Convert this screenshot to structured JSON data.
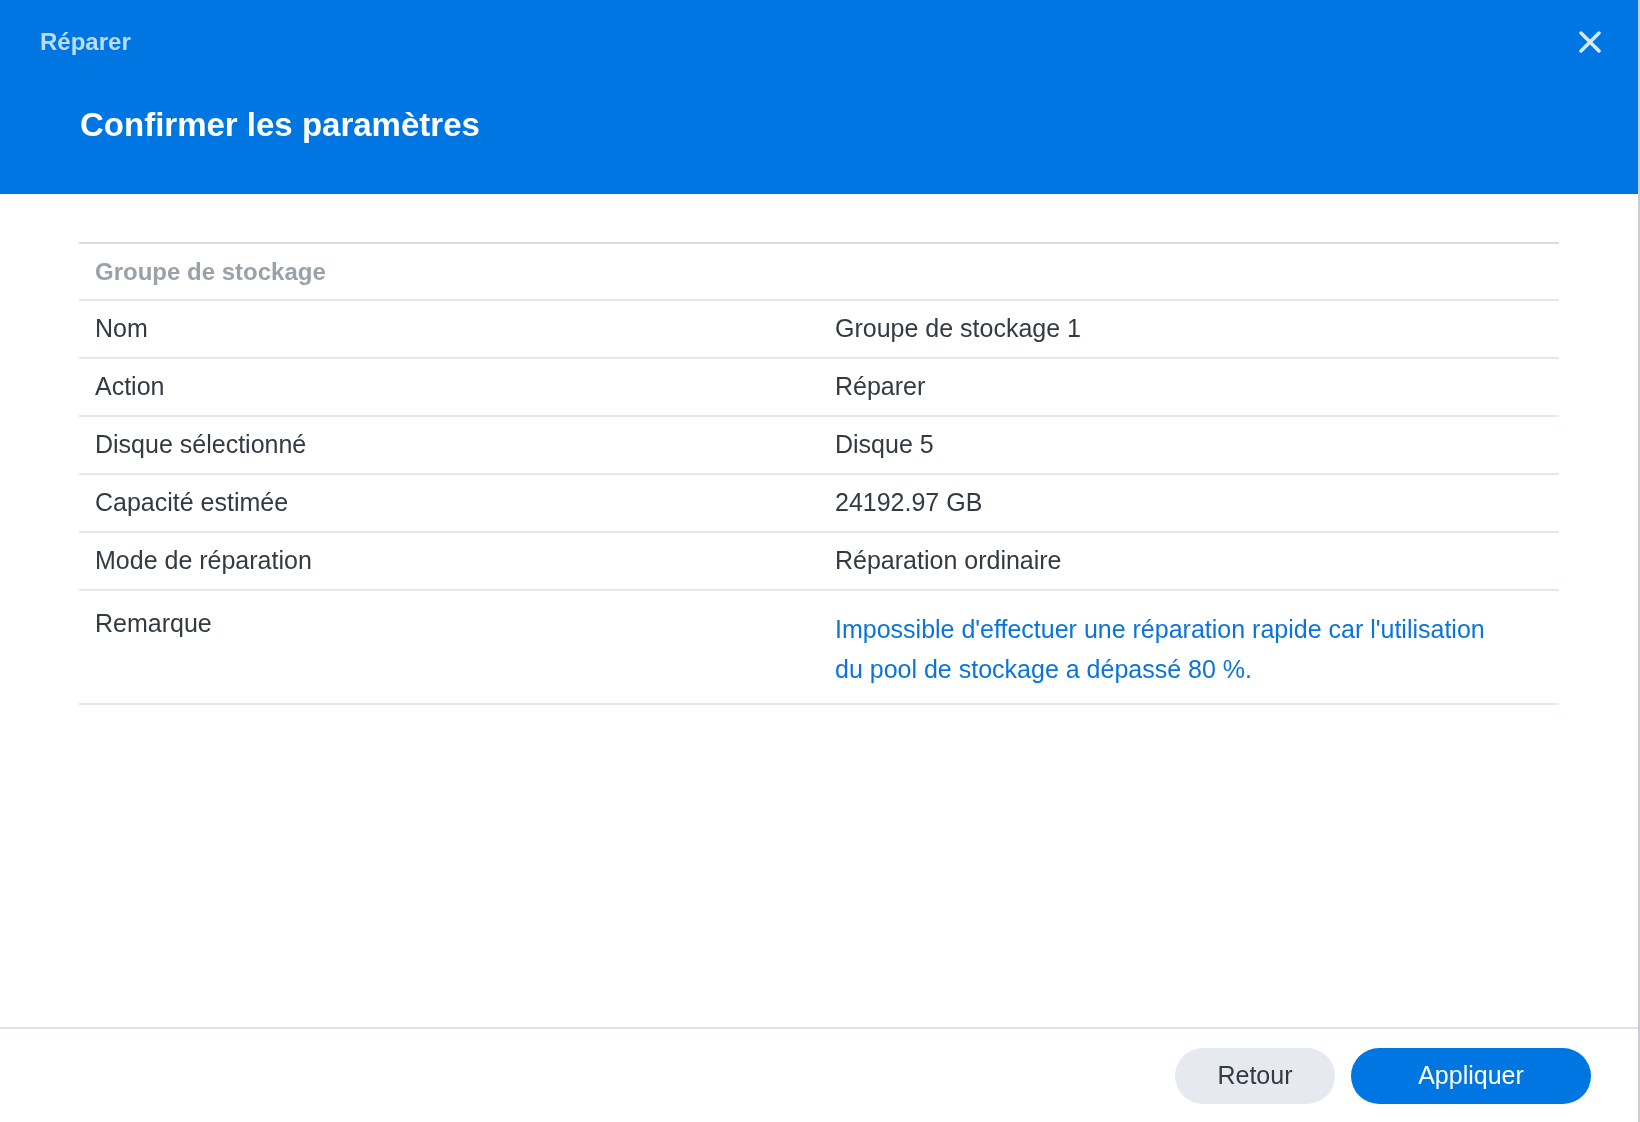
{
  "window": {
    "title": "Réparer"
  },
  "heading": "Confirmer les paramètres",
  "table": {
    "section": "Groupe de stockage",
    "rows": [
      {
        "label": "Nom",
        "value": "Groupe de stockage 1",
        "kind": "plain"
      },
      {
        "label": "Action",
        "value": "Réparer",
        "kind": "plain"
      },
      {
        "label": "Disque sélectionné",
        "value": "Disque 5",
        "kind": "plain"
      },
      {
        "label": "Capacité estimée",
        "value": "24192.97 GB",
        "kind": "plain"
      },
      {
        "label": "Mode de réparation",
        "value": "Réparation ordinaire",
        "kind": "plain"
      },
      {
        "label": "Remarque",
        "value": "Impossible d'effectuer une réparation rapide car l'utilisation du pool de stockage a dépassé 80 %.",
        "kind": "note"
      }
    ]
  },
  "buttons": [
    {
      "label": "Retour",
      "kind": "secondary"
    },
    {
      "label": "Appliquer",
      "kind": "primary"
    }
  ]
}
